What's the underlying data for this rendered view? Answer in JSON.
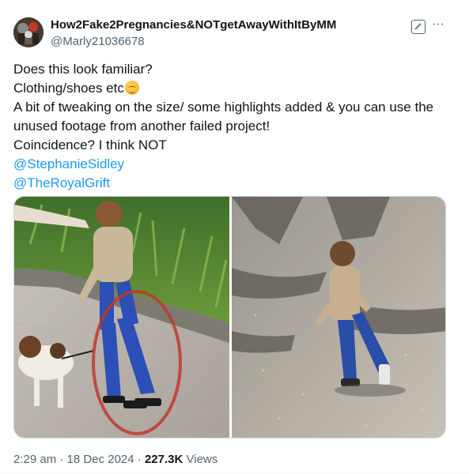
{
  "author": {
    "display_name": "How2Fake2Pregnancies&NOTgetAwayWithItByMM",
    "handle": "@Marly21036678"
  },
  "header_icons": [
    "grok-icon",
    "more-icon"
  ],
  "tweet": {
    "lines": [
      "Does this look familiar?",
      "Clothing/shoes etc",
      "A bit of tweaking on the size/ some highlights added & you can use the",
      "unused footage from another failed project!",
      "Coincidence? I think NOT"
    ],
    "emoji": "smiling-relieved-emoji",
    "mentions": [
      "@StephanieSidley",
      "@TheRoyalGrift"
    ]
  },
  "media": {
    "count": 2,
    "accent_red": "#c0392b"
  },
  "meta": {
    "time": "2:29 am",
    "sep1": " · ",
    "date": "18 Dec 2024",
    "sep2": " · ",
    "views_count": "227.3K",
    "views_label": " Views"
  },
  "colors": {
    "text": "#0f1419",
    "secondary": "#536471",
    "link": "#1d9bf0"
  }
}
